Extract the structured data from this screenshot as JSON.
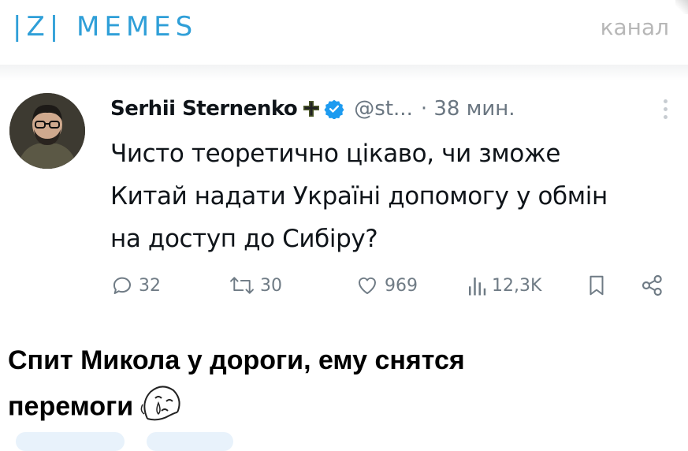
{
  "channel": {
    "logo_text": "|Z| MEMES",
    "tag": "канал",
    "accent_color": "#2f9fd8"
  },
  "tweet": {
    "author_name": "Serhii Sternenko",
    "flag_icon": "cross-flag-icon",
    "verified_icon": "verified-badge-icon",
    "handle": "@st...",
    "time": "· 38 мин.",
    "text_lines": [
      "Чисто теоретично цікаво, чи зможе",
      "Китай надати Україні допомогу у обмін",
      "на доступ до Сибіру?"
    ],
    "stats": {
      "replies": "32",
      "retweets": "30",
      "likes": "969",
      "views": "12,3K"
    }
  },
  "caption": {
    "line1": "Спит Микола у дороги, ему снятся",
    "line2": "перемоги",
    "emoji": "crying-face-icon"
  }
}
